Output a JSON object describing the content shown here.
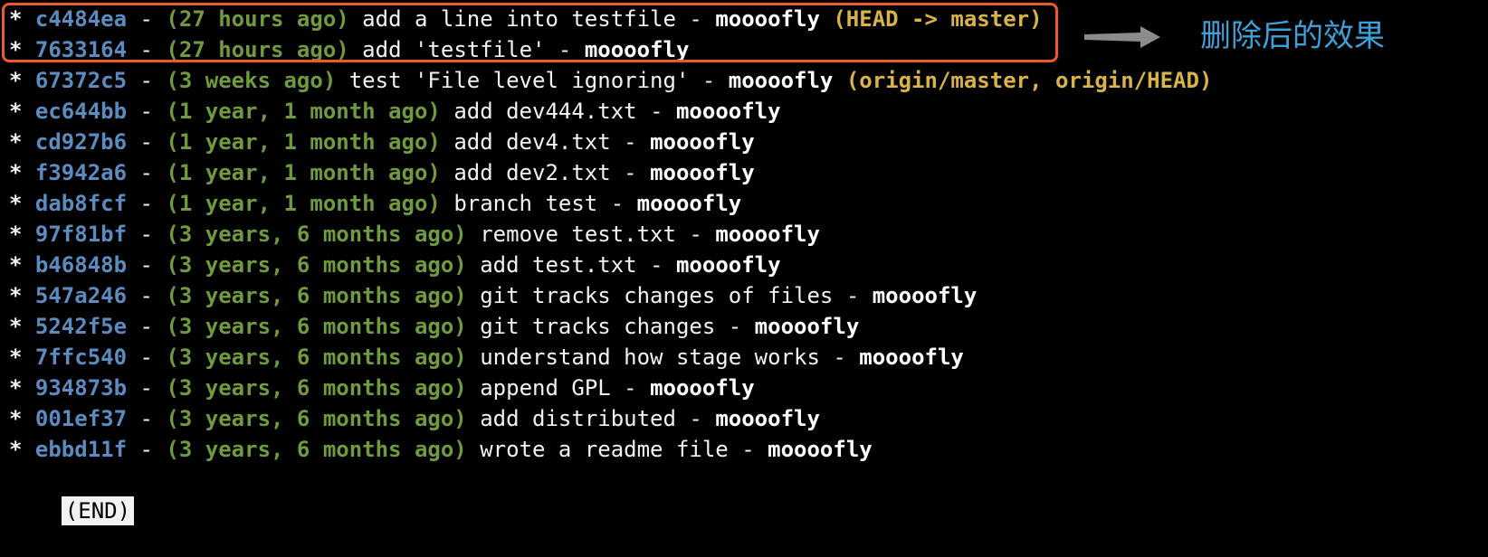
{
  "annotation": {
    "label": "删除后的效果",
    "box_color": "#ec5a2a",
    "arrow_color": "#8c8c8c",
    "text_color": "#3f9fd8"
  },
  "log": {
    "separator": "-",
    "commits": [
      {
        "hash": "c4484ea",
        "date": "(27 hours ago)",
        "message": "add a line into testfile",
        "author": "moooofly",
        "refs": "(HEAD -> master)"
      },
      {
        "hash": "7633164",
        "date": "(27 hours ago)",
        "message": "add 'testfile'",
        "author": "moooofly",
        "refs": ""
      },
      {
        "hash": "67372c5",
        "date": "(3 weeks ago)",
        "message": "test 'File level ignoring'",
        "author": "moooofly",
        "refs": "(origin/master, origin/HEAD)"
      },
      {
        "hash": "ec644bb",
        "date": "(1 year, 1 month ago)",
        "message": "add dev444.txt",
        "author": "moooofly",
        "refs": ""
      },
      {
        "hash": "cd927b6",
        "date": "(1 year, 1 month ago)",
        "message": "add dev4.txt",
        "author": "moooofly",
        "refs": ""
      },
      {
        "hash": "f3942a6",
        "date": "(1 year, 1 month ago)",
        "message": "add dev2.txt",
        "author": "moooofly",
        "refs": ""
      },
      {
        "hash": "dab8fcf",
        "date": "(1 year, 1 month ago)",
        "message": "branch test",
        "author": "moooofly",
        "refs": ""
      },
      {
        "hash": "97f81bf",
        "date": "(3 years, 6 months ago)",
        "message": "remove test.txt",
        "author": "moooofly",
        "refs": ""
      },
      {
        "hash": "b46848b",
        "date": "(3 years, 6 months ago)",
        "message": "add test.txt",
        "author": "moooofly",
        "refs": ""
      },
      {
        "hash": "547a246",
        "date": "(3 years, 6 months ago)",
        "message": "git tracks changes of files",
        "author": "moooofly",
        "refs": ""
      },
      {
        "hash": "5242f5e",
        "date": "(3 years, 6 months ago)",
        "message": "git tracks changes",
        "author": "moooofly",
        "refs": ""
      },
      {
        "hash": "7ffc540",
        "date": "(3 years, 6 months ago)",
        "message": "understand how stage works",
        "author": "moooofly",
        "refs": ""
      },
      {
        "hash": "934873b",
        "date": "(3 years, 6 months ago)",
        "message": "append GPL",
        "author": "moooofly",
        "refs": ""
      },
      {
        "hash": "001ef37",
        "date": "(3 years, 6 months ago)",
        "message": "add distributed",
        "author": "moooofly",
        "refs": ""
      },
      {
        "hash": "ebbd11f",
        "date": "(3 years, 6 months ago)",
        "message": "wrote a readme file",
        "author": "moooofly",
        "refs": ""
      }
    ],
    "end_marker": "(END)"
  }
}
